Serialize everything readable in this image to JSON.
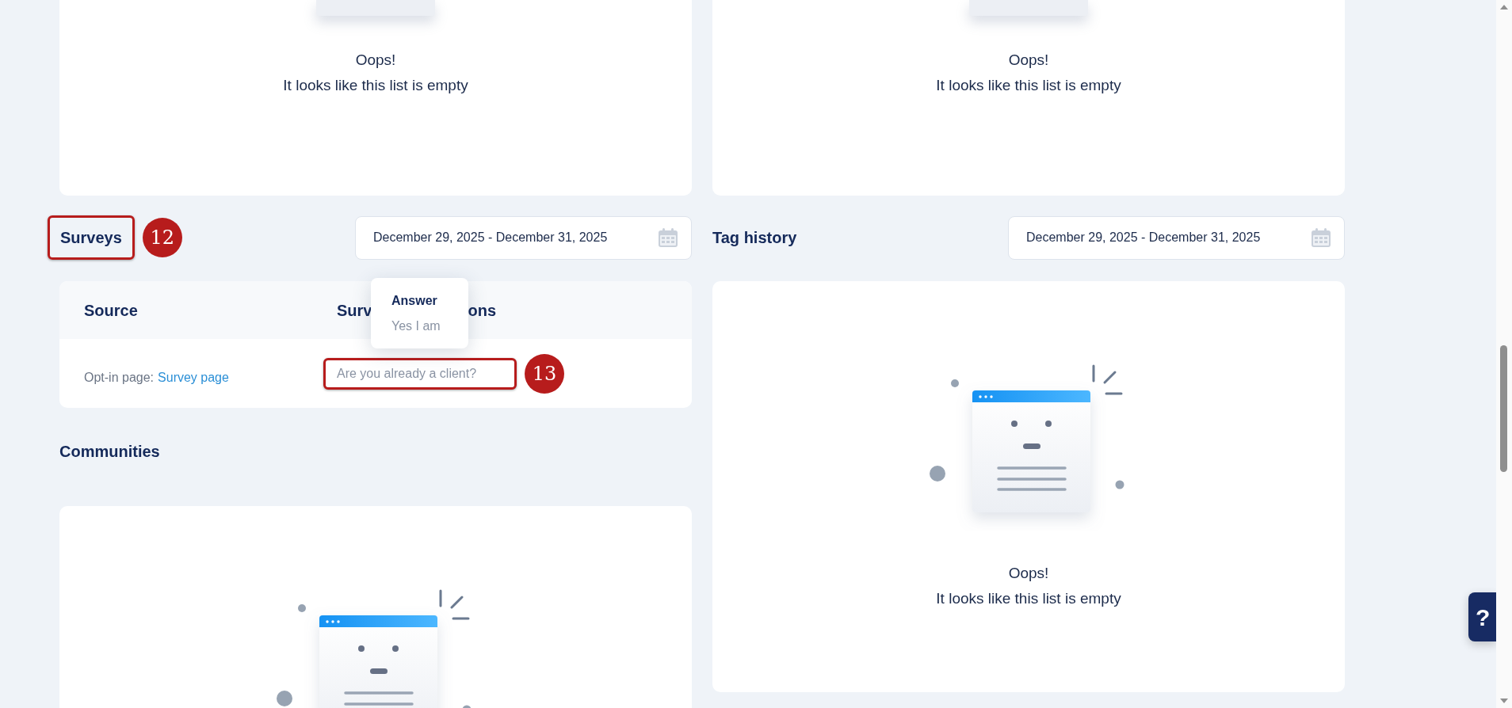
{
  "top_panels": [
    {
      "title": "Oops!",
      "message": "It looks like this list is empty"
    },
    {
      "title": "Oops!",
      "message": "It looks like this list is empty"
    }
  ],
  "surveys": {
    "title": "Surveys",
    "marker": "12",
    "date_range": "December 29, 2025 - December 31, 2025",
    "columns": [
      {
        "parts": [
          "Source"
        ]
      },
      {
        "parts": [
          "Surv",
          "ons"
        ]
      }
    ],
    "rows": [
      {
        "source_prefix": "Opt-in page:",
        "source_link": "Survey page",
        "question": "Are you already a client?",
        "question_marker": "13"
      }
    ],
    "tooltip": {
      "title": "Answer",
      "text": "Yes I am"
    }
  },
  "communities": {
    "title": "Communities"
  },
  "tag_history": {
    "title": "Tag history",
    "date_range": "December 29, 2025 - December 31, 2025",
    "empty": {
      "title": "Oops!",
      "message": "It looks like this list is empty"
    }
  },
  "help_button": {
    "label": "?"
  }
}
